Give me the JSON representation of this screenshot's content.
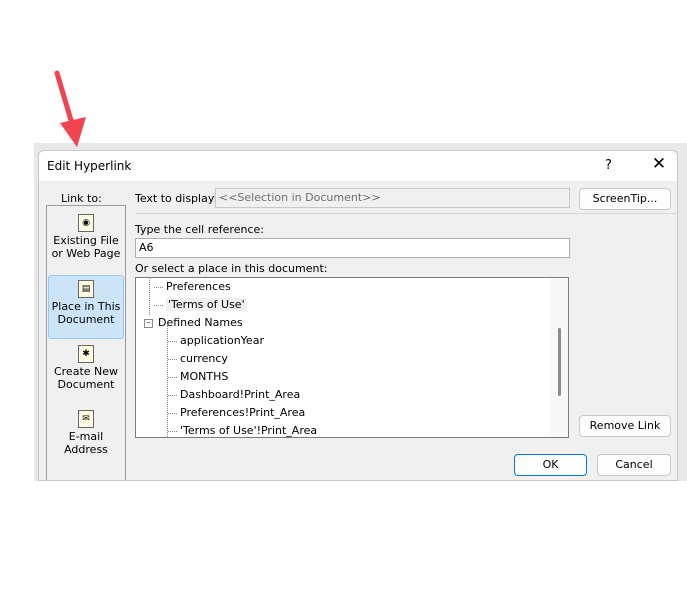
{
  "dialog": {
    "title": "Edit Hyperlink",
    "help": "?",
    "close": "✕"
  },
  "link_to": {
    "label": "Link to:",
    "items": [
      {
        "label1": "Existing File",
        "label2": "or Web Page",
        "icon": "web-page-icon",
        "selected": false
      },
      {
        "label1": "Place in This",
        "label2": "Document",
        "icon": "place-in-document-icon",
        "selected": true
      },
      {
        "label1": "Create New",
        "label2": "Document",
        "icon": "new-document-icon",
        "selected": false
      },
      {
        "label1": "E-mail",
        "label2": "Address",
        "icon": "email-icon",
        "selected": false
      }
    ]
  },
  "text_to_display": {
    "label": "Text to display:",
    "value": "<<Selection in Document>>"
  },
  "cell_reference": {
    "label": "Type the cell reference:",
    "value": "A6"
  },
  "place": {
    "label": "Or select a place in this document:",
    "sheets": [
      "Preferences",
      "'Terms of Use'"
    ],
    "defined_names_label": "Defined Names",
    "names": [
      "applicationYear",
      "currency",
      "MONTHS",
      "Dashboard!Print_Area",
      "Preferences!Print_Area",
      "'Terms of Use'!Print_Area"
    ]
  },
  "buttons": {
    "screentip": "ScreenTip...",
    "remove_link": "Remove Link",
    "ok": "OK",
    "cancel": "Cancel"
  },
  "colors": {
    "annotation_arrow": "#f0454f",
    "selected": "#cce4f7",
    "default_button_border": "#0078d4"
  }
}
